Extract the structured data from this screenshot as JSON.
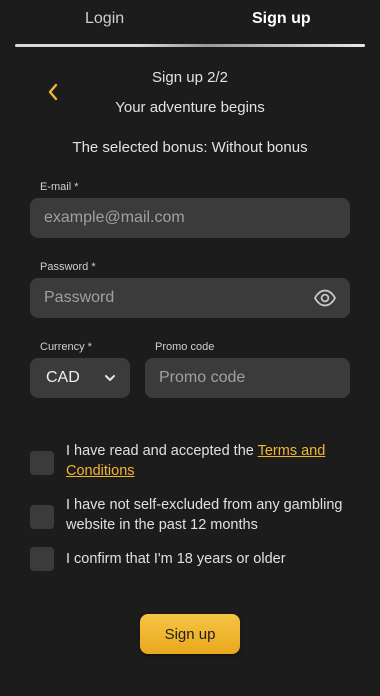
{
  "tabs": {
    "login": "Login",
    "signup": "Sign up"
  },
  "header": {
    "step": "Sign up 2/2",
    "subtitle": "Your adventure begins",
    "bonus": "The selected bonus: Without bonus"
  },
  "form": {
    "email_label": "E-mail *",
    "email_placeholder": "example@mail.com",
    "password_label": "Password *",
    "password_placeholder": "Password",
    "currency_label": "Currency *",
    "currency_value": "CAD",
    "promo_label": "Promo code",
    "promo_placeholder": "Promo code"
  },
  "checkboxes": {
    "terms_prefix": "I have read and accepted the ",
    "terms_link": "Terms and Conditions",
    "self_excluded": "I have not self-excluded from any gambling website in the past 12 months",
    "age": "I confirm that I'm 18 years or older"
  },
  "submit_label": "Sign up",
  "colors": {
    "accent": "#f2b632",
    "background": "#1c1c1c",
    "field": "#3b3b3b"
  }
}
